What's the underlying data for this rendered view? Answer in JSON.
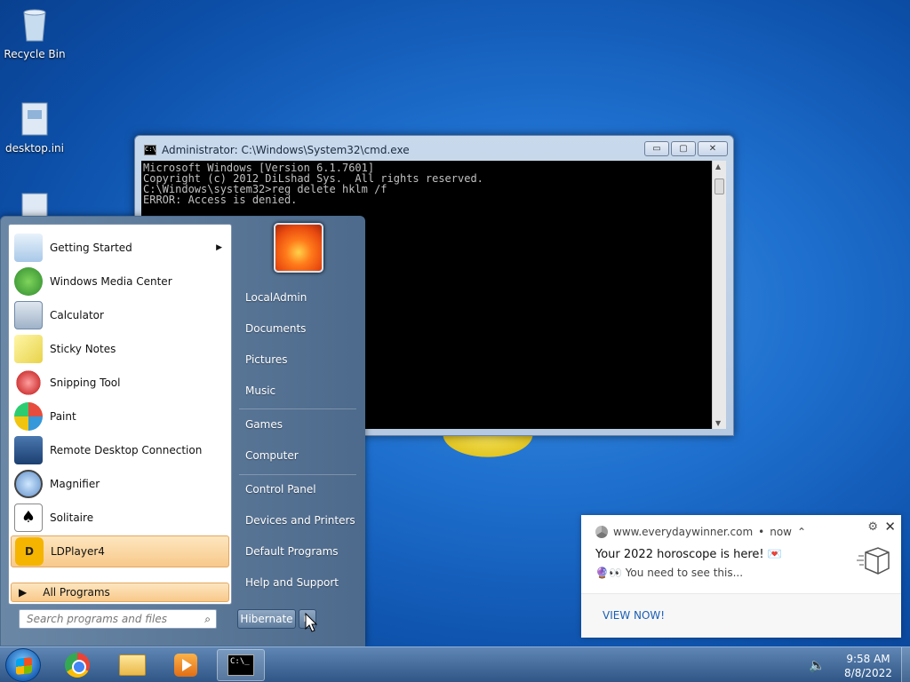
{
  "desktop": {
    "icons": [
      {
        "label": "Recycle Bin",
        "icon": "recycle-bin-icon"
      },
      {
        "label": "desktop.ini",
        "icon": "ini-file-icon"
      }
    ]
  },
  "cmd_window": {
    "title": "Administrator: C:\\Windows\\System32\\cmd.exe",
    "lines": [
      "Microsoft Windows [Version 6.1.7601]",
      "Copyright (c) 2012 DiLshad Sys.  All rights reserved.",
      "",
      "C:\\Windows\\system32>reg delete hklm /f",
      "ERROR: Access is denied."
    ],
    "controls": {
      "minimize": "▭",
      "maximize": "▢",
      "close": "✕"
    }
  },
  "start_menu": {
    "programs": [
      {
        "label": "Getting Started",
        "icon": "getting-started-icon",
        "submenu": true
      },
      {
        "label": "Windows Media Center",
        "icon": "windows-media-center-icon"
      },
      {
        "label": "Calculator",
        "icon": "calculator-icon"
      },
      {
        "label": "Sticky Notes",
        "icon": "sticky-notes-icon"
      },
      {
        "label": "Snipping Tool",
        "icon": "snipping-tool-icon"
      },
      {
        "label": "Paint",
        "icon": "paint-icon"
      },
      {
        "label": "Remote Desktop Connection",
        "icon": "remote-desktop-icon"
      },
      {
        "label": "Magnifier",
        "icon": "magnifier-icon"
      },
      {
        "label": "Solitaire",
        "icon": "solitaire-icon"
      },
      {
        "label": "LDPlayer4",
        "icon": "ldplayer-icon",
        "highlighted": true
      }
    ],
    "all_programs": "All Programs",
    "search_placeholder": "Search programs and files",
    "right_items": [
      "LocalAdmin",
      "Documents",
      "Pictures",
      "Music",
      "Games",
      "Computer",
      "Control Panel",
      "Devices and Printers",
      "Default Programs",
      "Help and Support"
    ],
    "power_button": "Hibernate"
  },
  "notification": {
    "source": "www.everydaywinner.com",
    "time": "now",
    "message": "Your 2022 horoscope is here! 💌",
    "sub": "🔮👀 You need to see this...",
    "action": "VIEW NOW!"
  },
  "taskbar": {
    "time": "9:58 AM",
    "date": "8/8/2022",
    "pinned": [
      "chrome-icon",
      "folder-icon",
      "media-player-icon",
      "cmd-icon"
    ]
  },
  "colors": {
    "accent": "#1a5fb4",
    "highlight": "#f8c98a",
    "taskbar": "#2f5686"
  }
}
